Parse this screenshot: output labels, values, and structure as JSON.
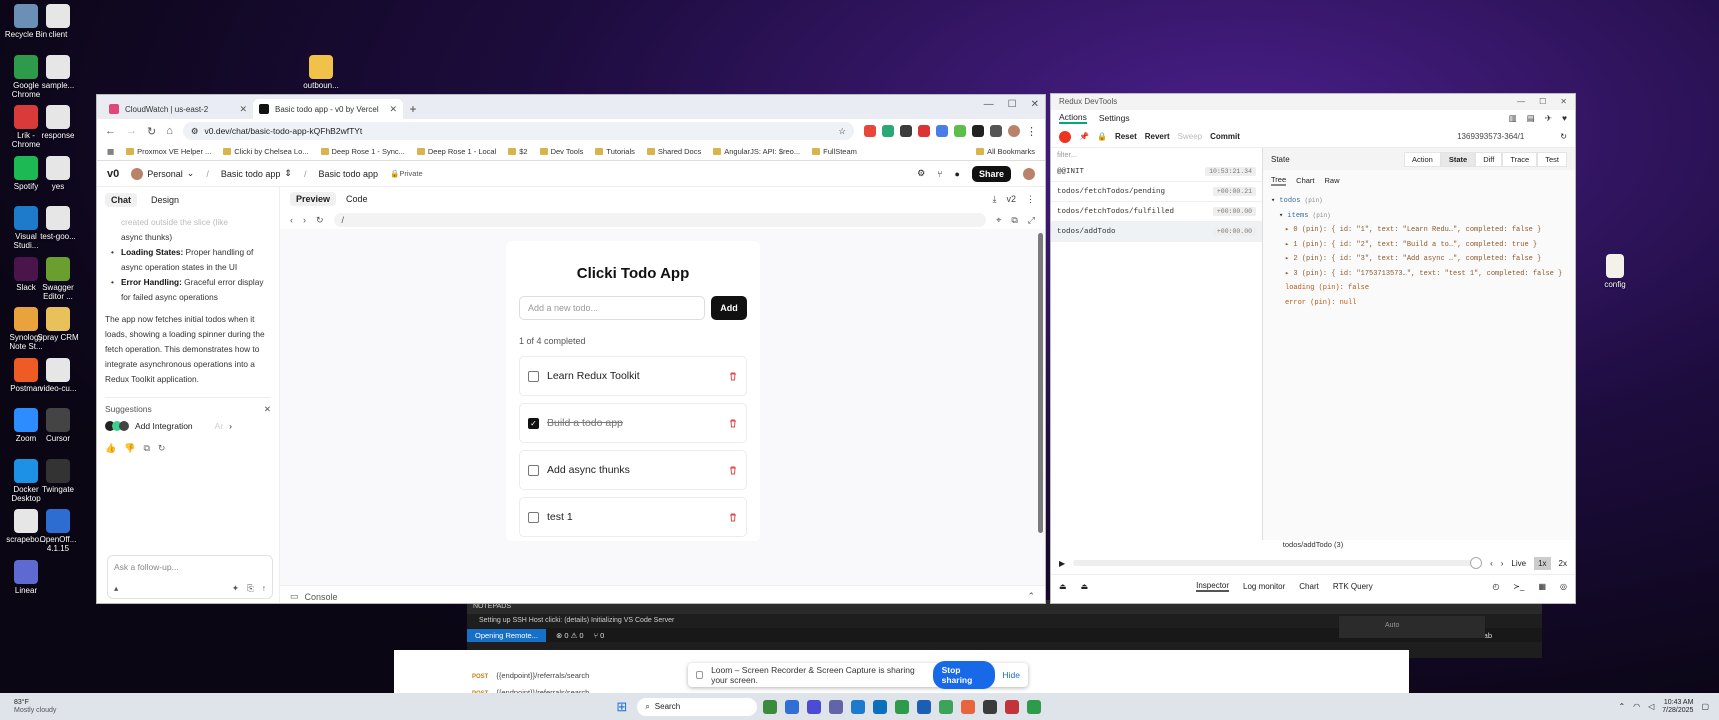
{
  "desktop": {
    "icons_left": [
      {
        "label": "Recycle Bin",
        "icon": "recycle-bin-icon",
        "color": "#6b8fb5"
      },
      {
        "label": "client",
        "icon": "file-icon",
        "color": "#e6e6e6"
      },
      {
        "label": "Google Chrome",
        "icon": "chrome-icon",
        "color": "#2d9b4a"
      },
      {
        "label": "sample...",
        "icon": "file-icon",
        "color": "#e6e6e6"
      },
      {
        "label": "Lrik - Chrome",
        "icon": "chrome-icon",
        "color": "#d93b3b"
      },
      {
        "label": "response",
        "icon": "file-icon",
        "color": "#e6e6e6"
      },
      {
        "label": "Spotify",
        "icon": "spotify-icon",
        "color": "#1db954"
      },
      {
        "label": "yes",
        "icon": "file-icon",
        "color": "#e6e6e6"
      },
      {
        "label": "Visual Studi...",
        "icon": "vscode-icon",
        "color": "#1e7acb"
      },
      {
        "label": "test-goo...",
        "icon": "file-icon",
        "color": "#e6e6e6"
      },
      {
        "label": "Slack",
        "icon": "slack-icon",
        "color": "#4a154b"
      },
      {
        "label": "Swagger Editor ...",
        "icon": "swagger-icon",
        "color": "#6a9e2f"
      },
      {
        "label": "Synology Note St...",
        "icon": "note-icon",
        "color": "#e8a33d"
      },
      {
        "label": "Spray CRM",
        "icon": "folder-icon",
        "color": "#e8c15a"
      },
      {
        "label": "Postman",
        "icon": "postman-icon",
        "color": "#ef5b25"
      },
      {
        "label": "video-cu...",
        "icon": "file-icon",
        "color": "#e6e6e6"
      },
      {
        "label": "Zoom",
        "icon": "zoom-icon",
        "color": "#2d8cff"
      },
      {
        "label": "Cursor",
        "icon": "cursor-icon",
        "color": "#444444"
      },
      {
        "label": "Docker Desktop",
        "icon": "docker-icon",
        "color": "#1d91e6"
      },
      {
        "label": "Twingate",
        "icon": "twingate-icon",
        "color": "#333333"
      },
      {
        "label": "scrapebo...",
        "icon": "file-icon",
        "color": "#e6e6e6"
      },
      {
        "label": "OpenOff... 4.1.15",
        "icon": "openoffice-icon",
        "color": "#2d6dd1"
      },
      {
        "label": "Linear",
        "icon": "linear-icon",
        "color": "#5e6ad2"
      }
    ],
    "folder_mid": {
      "label": "outboun...",
      "icon": "folder-icon",
      "color": "#f0c24a"
    },
    "config_icon": {
      "label": "config",
      "icon": "file-icon",
      "color": "#f0c24a"
    }
  },
  "browser": {
    "tabs": [
      {
        "label": "CloudWatch | us-east-2",
        "color": "#e0467a"
      },
      {
        "label": "Basic todo app - v0 by Vercel",
        "color": "#111111"
      }
    ],
    "new_tab": "+",
    "url": "v0.dev/chat/basic-todo-app-kQFhB2wfTYt",
    "bookmarks": [
      "Proxmox VE Helper ...",
      "Clicki by Chelsea Lo...",
      "Deep Rose 1 - Sync...",
      "Deep Rose 1 - Local",
      "$2",
      "Dev Tools",
      "Tutorials",
      "Shared Docs",
      "AngularJS: API: $reo...",
      "FullSteam",
      "All Bookmarks"
    ]
  },
  "v0": {
    "logo": "v0",
    "workspace": "Personal",
    "project": "Basic todo app",
    "chat_title": "Basic todo app",
    "visibility": "Private",
    "share": "Share",
    "chat_tab": "Chat",
    "design_tab": "Design",
    "chat": {
      "line0": "created outside the slice (like",
      "line0b": "async thunks)",
      "loading_b": "Loading States:",
      "loading_t": " Proper handling of async operation states in the UI",
      "error_b": "Error Handling:",
      "error_t": " Graceful error display for failed async operations",
      "para": "The app now fetches initial todos when it loads, showing a loading spinner during the fetch operation. This demonstrates how to integrate asynchronous operations into a Redux Toolkit application."
    },
    "suggestions_label": "Suggestions",
    "suggestion": "Add Integration",
    "suggestion_more": "Ar",
    "followup_placeholder": "Ask a follow-up...",
    "preview_tab": "Preview",
    "code_tab": "Code",
    "version": "v2",
    "path": "/",
    "console": "Console"
  },
  "todo_app": {
    "title": "Clicki Todo App",
    "placeholder": "Add a new todo...",
    "add": "Add",
    "count": "1 of 4 completed",
    "items": [
      {
        "text": "Learn Redux Toolkit",
        "done": false
      },
      {
        "text": "Build a todo app",
        "done": true
      },
      {
        "text": "Add async thunks",
        "done": false
      },
      {
        "text": "test 1",
        "done": false
      }
    ]
  },
  "devtools": {
    "window_title": "Redux DevTools",
    "tab_actions": "Actions",
    "tab_settings": "Settings",
    "reset": "Reset",
    "revert": "Revert",
    "sweep": "Sweep",
    "commit": "Commit",
    "instance": "1369393573-364/1",
    "filter": "filter...",
    "actions": [
      {
        "name": "@@INIT",
        "time": "10:53:21.34"
      },
      {
        "name": "todos/fetchTodos/pending",
        "time": "+00:00.21"
      },
      {
        "name": "todos/fetchTodos/fulfilled",
        "time": "+00:00.00"
      },
      {
        "name": "todos/addTodo",
        "time": "+00:00.00"
      }
    ],
    "state_label": "State",
    "view_tabs": [
      "Action",
      "State",
      "Diff",
      "Trace",
      "Test"
    ],
    "sub_tabs": [
      "Tree",
      "Chart",
      "Raw"
    ],
    "tree": {
      "root": "todos",
      "items_key": "items",
      "pin": "(pin)",
      "rows": [
        "0 (pin): { id: \"1\", text: \"Learn Redu…\", completed: false }",
        "1 (pin): { id: \"2\", text: \"Build a to…\", completed: true }",
        "2 (pin): { id: \"3\", text: \"Add async …\", completed: false }",
        "3 (pin): { id: \"1753713573…\", text: \"test 1\", completed: false }"
      ],
      "loading": "loading (pin): false",
      "error": "error (pin): null"
    },
    "slider_label": "todos/addTodo (3)",
    "live": "Live",
    "speed1": "1x",
    "speed2": "2x",
    "bottom_tabs": [
      "Inspector",
      "Log monitor",
      "Chart",
      "RTK Query"
    ]
  },
  "vscode": {
    "notepads": "NOTEPADS",
    "status": "Setting up SSH Host clicki: (details) Initializing VS Code Server",
    "remote": "Opening Remote...",
    "problems": "⊗ 0 ⚠ 0",
    "ports": "⑂ 0",
    "cursor_tab": "Cursor Tab",
    "search_hint": "Auto"
  },
  "postman": {
    "row1_method": "POST",
    "row1_url": "{{endpoint}}/referrals/search",
    "row2_method": "POST",
    "row2_url": "{{endpoint}}/referrals/search"
  },
  "loom": {
    "text": "Loom – Screen Recorder & Screen Capture is sharing your screen.",
    "stop": "Stop sharing",
    "hide": "Hide"
  },
  "taskbar": {
    "weather_temp": "83°F",
    "weather_desc": "Mostly cloudy",
    "search": "Search",
    "time": "10:43 AM",
    "date": "7/28/2025"
  }
}
